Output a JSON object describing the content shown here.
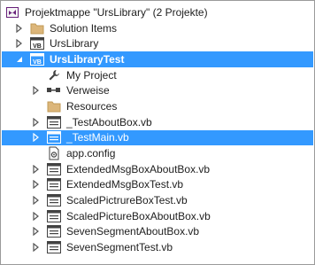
{
  "tree": {
    "solution_label": "Projektmappe \"UrsLibrary\" (2 Projekte)",
    "items": [
      {
        "label": "Solution Items"
      },
      {
        "label": "UrsLibrary"
      },
      {
        "label": "UrsLibraryTest"
      },
      {
        "label": "My Project"
      },
      {
        "label": "Verweise"
      },
      {
        "label": "Resources"
      },
      {
        "label": "_TestAboutBox.vb"
      },
      {
        "label": "_TestMain.vb"
      },
      {
        "label": "app.config"
      },
      {
        "label": "ExtendedMsgBoxAboutBox.vb"
      },
      {
        "label": "ExtendedMsgBoxTest.vb"
      },
      {
        "label": "ScaledPictrureBoxTest.vb"
      },
      {
        "label": "ScaledPictureBoxAboutBox.vb"
      },
      {
        "label": "SevenSegmentAboutBox.vb"
      },
      {
        "label": "SevenSegmentTest.vb"
      }
    ]
  },
  "colors": {
    "selection": "#3399ff",
    "vs_purple": "#68217a",
    "folder": "#dcb67a",
    "wrench": "#424242"
  }
}
